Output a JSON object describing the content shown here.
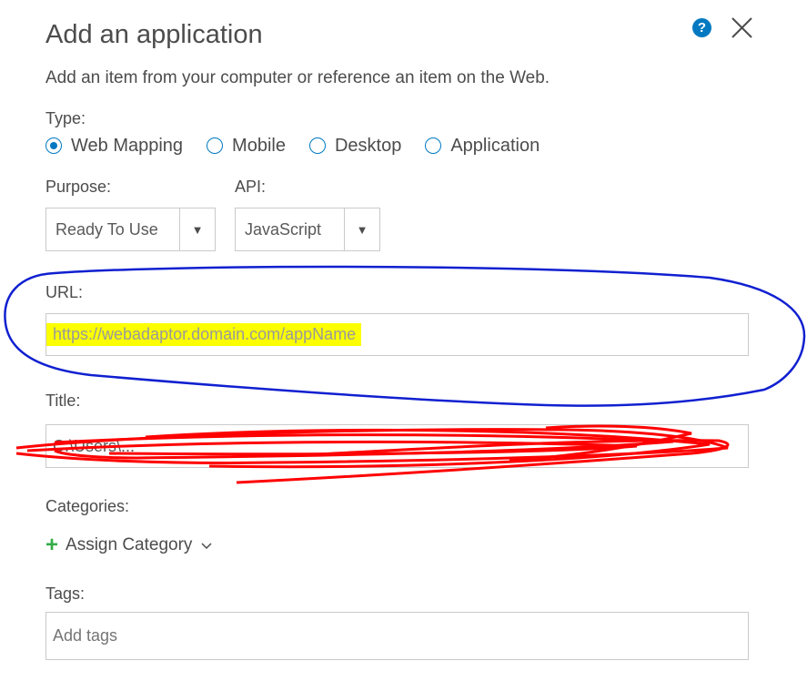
{
  "dialog": {
    "title": "Add an application",
    "help_icon": "question-circle-icon",
    "help_glyph": "?",
    "close_icon": "close-x-icon",
    "subtitle": "Add an item from your computer or reference an item on the Web."
  },
  "type": {
    "label": "Type:",
    "options": [
      {
        "label": "Web Mapping",
        "checked": true
      },
      {
        "label": "Mobile",
        "checked": false
      },
      {
        "label": "Desktop",
        "checked": false
      },
      {
        "label": "Application",
        "checked": false
      }
    ]
  },
  "purpose": {
    "label": "Purpose:",
    "value": "Ready To Use",
    "arrow": "▼"
  },
  "api": {
    "label": "API:",
    "value": "JavaScript",
    "arrow": "▼"
  },
  "url": {
    "label": "URL:",
    "value": "https://webadaptor.domain.com/appName"
  },
  "title_field": {
    "label": "Title:",
    "value": "C:\\Users\\..."
  },
  "categories": {
    "label": "Categories:",
    "assign_label": "Assign Category",
    "plus_glyph": "+"
  },
  "tags": {
    "label": "Tags:",
    "placeholder": "Add tags"
  },
  "colors": {
    "accent": "#0079c1",
    "plus": "#35ac46",
    "highlight": "#fbff00",
    "annotation_blue": "#1020d0",
    "annotation_red": "#ff0000"
  }
}
